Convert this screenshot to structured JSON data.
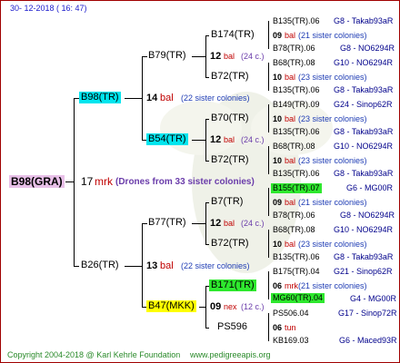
{
  "header": {
    "date": "30- 12-2018 ( 16: 47)"
  },
  "footer": {
    "copyright": "Copyright 2004-2018 @ Karl Kehrle Foundation",
    "website": "www.pedigreeapis.org"
  },
  "colors": {
    "cyan": "#00e5ee",
    "green": "#2ee82e",
    "yellow": "#ffff00",
    "pink": "#e8c0e8",
    "red": "#c00000",
    "blue": "#1e3cb4",
    "purple": "#6a3caa"
  },
  "root": {
    "name": "B98(GRA)",
    "gen_num": "17",
    "mark_label": "mrk",
    "note": "(Drones from 33 sister colonies)"
  },
  "level1": [
    {
      "name": "B98(TR)",
      "num": "14",
      "mark": "bal",
      "note": "(22 sister colonies)"
    },
    {
      "name": "B26(TR)",
      "num": "13",
      "mark": "bal",
      "note": "(22 sister colonies)"
    }
  ],
  "level2": [
    {
      "name": "B79(TR)",
      "num": "12",
      "mark": "bal",
      "note": "(24 c.)"
    },
    {
      "name": "B54(TR)",
      "num": "12",
      "mark": "bal",
      "note": "(24 c.)"
    },
    {
      "name": "B77(TR)",
      "num": "12",
      "mark": "bal",
      "note": "(24 c.)"
    },
    {
      "name": "B47(MKK)",
      "num": "09",
      "mark": "nex",
      "note": "(12 c.)"
    }
  ],
  "level3": [
    {
      "name": "B174(TR)",
      "num": "09",
      "mark": "bal",
      "note": "(21 sister colonies)"
    },
    {
      "name": "B72(TR)",
      "num": "10",
      "mark": "bal",
      "note": "(23 sister colonies)"
    },
    {
      "name": "B70(TR)",
      "num": "10",
      "mark": "bal",
      "note": "(23 sister colonies)"
    },
    {
      "name": "B72(TR)",
      "num": "10",
      "mark": "bal",
      "note": "(23 sister colonies)"
    },
    {
      "name": "B7(TR)",
      "num": "09",
      "mark": "bal",
      "note": "(21 sister colonies)"
    },
    {
      "name": "B72(TR)",
      "num": "10",
      "mark": "bal",
      "note": "(23 sister colonies)"
    },
    {
      "name": "B171(TR)",
      "num": "06",
      "mark": "mrk",
      "note": "(21 sister colonies)"
    },
    {
      "name": "PS596",
      "num": "06",
      "mark": "tun",
      "note": ""
    }
  ],
  "level4": [
    {
      "name": "B135(TR).06",
      "group": "G8 - Takab93aR"
    },
    {
      "name": "B78(TR).06",
      "group": "G8 - NO6294R"
    },
    {
      "name": "B68(TR).08",
      "group": "G10 - NO6294R"
    },
    {
      "name": "B135(TR).06",
      "group": "G8 - Takab93aR"
    },
    {
      "name": "B149(TR).09",
      "group": "G24 - Sinop62R"
    },
    {
      "name": "B135(TR).06",
      "group": "G8 - Takab93aR"
    },
    {
      "name": "B68(TR).08",
      "group": "G10 - NO6294R"
    },
    {
      "name": "B135(TR).06",
      "group": "G8 - Takab93aR"
    },
    {
      "name": "B155(TR).07",
      "group": "G6 - MG00R"
    },
    {
      "name": "B78(TR).06",
      "group": "G8 - NO6294R"
    },
    {
      "name": "B68(TR).08",
      "group": "G10 - NO6294R"
    },
    {
      "name": "B135(TR).06",
      "group": "G8 - Takab93aR"
    },
    {
      "name": "B175(TR).04",
      "group": "G21 - Sinop62R"
    },
    {
      "name": "MG60(TR).04",
      "group": "G4 - MG00R"
    },
    {
      "name": "PS506.04",
      "group": "G17 - Sinop72R"
    },
    {
      "name": "KB169.03",
      "group": "G6 - Maced93R"
    }
  ]
}
